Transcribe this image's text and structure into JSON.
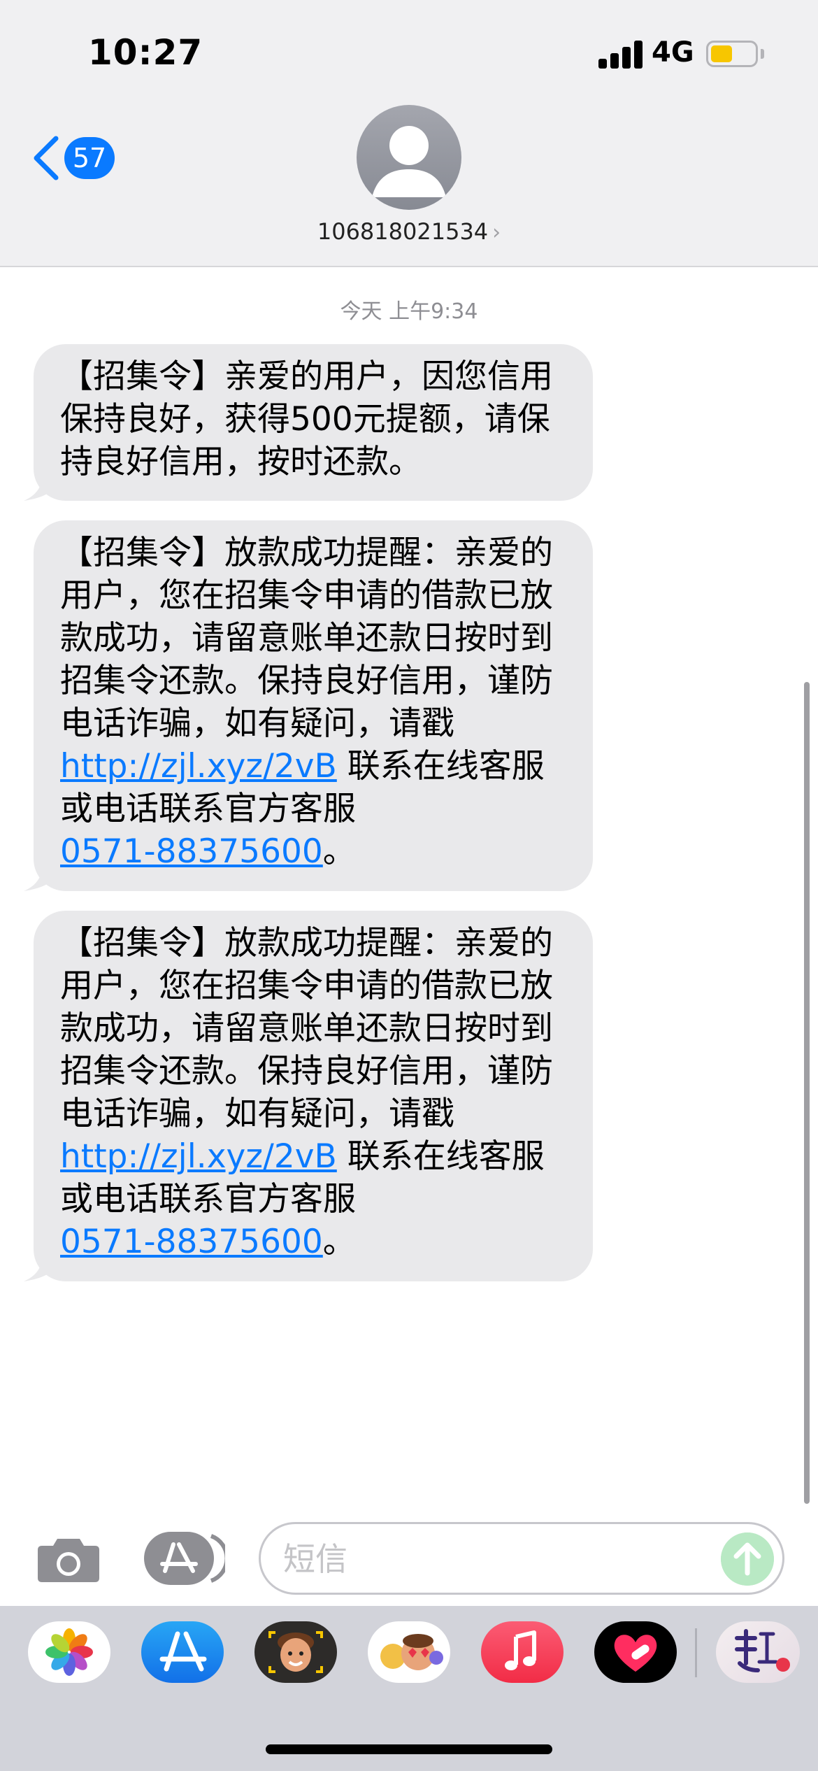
{
  "status_bar": {
    "time": "10:27",
    "network": "4G",
    "battery_level": 0.5,
    "battery_color": "#f7c600"
  },
  "header": {
    "back_icon": "chevron-left-icon",
    "unread_count": "57",
    "avatar_icon": "person-silhouette-icon",
    "contact": "106818021534",
    "contact_chevron": "›"
  },
  "conversation": {
    "timestamp": "今天 上午9:34",
    "messages": [
      {
        "text": "【招集令】亲爱的用户，因您信用保持良好，获得500元提额，请保持良好信用，按时还款。"
      },
      {
        "text_before": "【招集令】放款成功提醒：亲爱的用户，您在招集令申请的借款已放款成功，请留意账单还款日按时到招集令还款。保持良好信用，谨防电话诈骗，如有疑问，请戳 ",
        "link": "http://zjl.xyz/2vB",
        "text_middle": " 联系在线客服或电话联系官方客服",
        "phone": "0571-88375600",
        "text_after": "。"
      },
      {
        "text_before": "【招集令】放款成功提醒：亲爱的用户，您在招集令申请的借款已放款成功，请留意账单还款日按时到招集令还款。保持良好信用，谨防电话诈骗，如有疑问，请戳 ",
        "link": "http://zjl.xyz/2vB",
        "text_middle": " 联系在线客服或电话联系官方客服",
        "phone": "0571-88375600",
        "text_after": "。"
      }
    ],
    "bubble_color": "#e9e9eb",
    "link_color": "#0a7aff"
  },
  "compose": {
    "camera_icon": "camera-icon",
    "apps_icon": "app-store-icon",
    "placeholder": "短信",
    "send_icon": "arrow-up-icon"
  },
  "app_drawer": {
    "apps": [
      {
        "name": "photos",
        "icon": "photos-icon"
      },
      {
        "name": "app-store",
        "icon": "app-store-icon"
      },
      {
        "name": "memoji",
        "icon": "memoji-icon"
      },
      {
        "name": "memoji-stickers",
        "icon": "memoji-stickers-icon"
      },
      {
        "name": "music",
        "icon": "music-note-icon"
      },
      {
        "name": "digital-touch",
        "icon": "heart-icon"
      },
      {
        "name": "sticker-app",
        "icon": "sticker-icon"
      }
    ]
  }
}
